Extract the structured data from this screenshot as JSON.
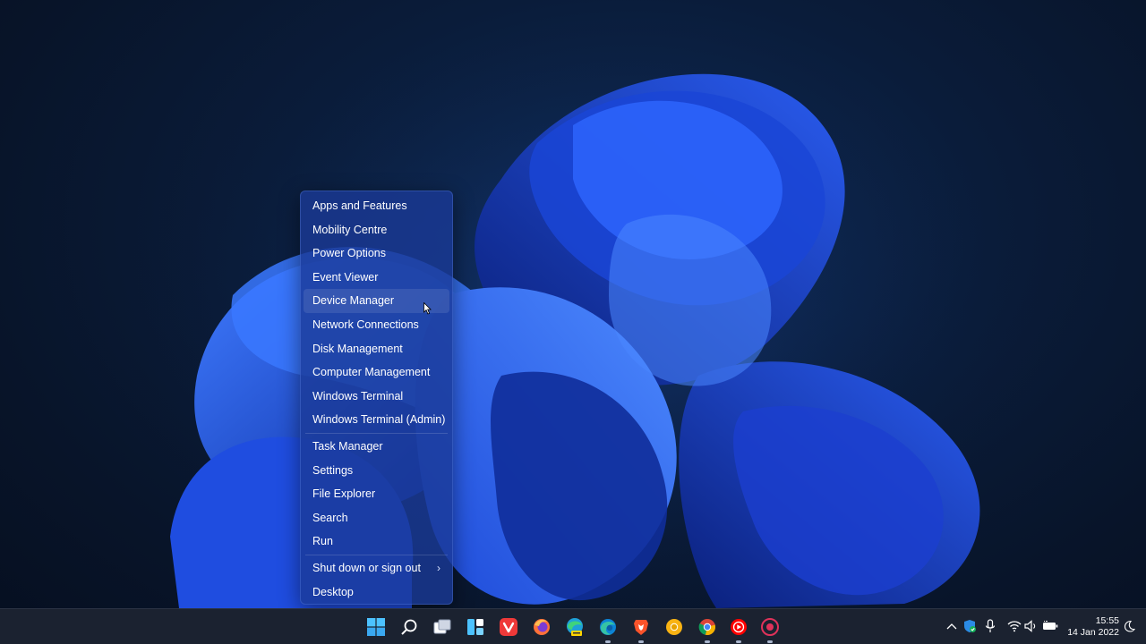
{
  "menu": {
    "group1": [
      {
        "label": "Apps and Features"
      },
      {
        "label": "Mobility Centre"
      },
      {
        "label": "Power Options"
      },
      {
        "label": "Event Viewer"
      },
      {
        "label": "Device Manager"
      },
      {
        "label": "Network Connections"
      },
      {
        "label": "Disk Management"
      },
      {
        "label": "Computer Management"
      },
      {
        "label": "Windows Terminal"
      },
      {
        "label": "Windows Terminal (Admin)"
      }
    ],
    "group2": [
      {
        "label": "Task Manager"
      },
      {
        "label": "Settings"
      },
      {
        "label": "File Explorer"
      },
      {
        "label": "Search"
      },
      {
        "label": "Run"
      }
    ],
    "group3": [
      {
        "label": "Shut down or sign out",
        "chevron": "›"
      },
      {
        "label": "Desktop"
      }
    ],
    "hovered_item": "Device Manager"
  },
  "taskbar": {
    "pinned": [
      {
        "name": "start-icon",
        "running": false
      },
      {
        "name": "search-icon",
        "running": false
      },
      {
        "name": "task-view-icon",
        "running": false
      },
      {
        "name": "widgets-icon",
        "running": false
      },
      {
        "name": "vivaldi-icon",
        "running": false
      },
      {
        "name": "firefox-icon",
        "running": false
      },
      {
        "name": "edge-canary-icon",
        "running": false
      },
      {
        "name": "edge-icon",
        "running": true
      },
      {
        "name": "brave-icon",
        "running": true
      },
      {
        "name": "chrome-canary-icon",
        "running": false
      },
      {
        "name": "chrome-icon",
        "running": true
      },
      {
        "name": "youtube-music-icon",
        "running": true
      },
      {
        "name": "screen-recorder-icon",
        "running": true
      }
    ],
    "tray": {
      "icons": [
        "chevron-up-icon",
        "shield-icon",
        "microphone-icon",
        "wifi-icon",
        "volume-icon",
        "battery-icon"
      ],
      "time": "15:55",
      "date": "14 Jan 2022"
    }
  },
  "colors": {
    "accent": "#2f6bff",
    "menu_bg": "#1a3a96",
    "taskbar_bg": "#1b2230"
  }
}
